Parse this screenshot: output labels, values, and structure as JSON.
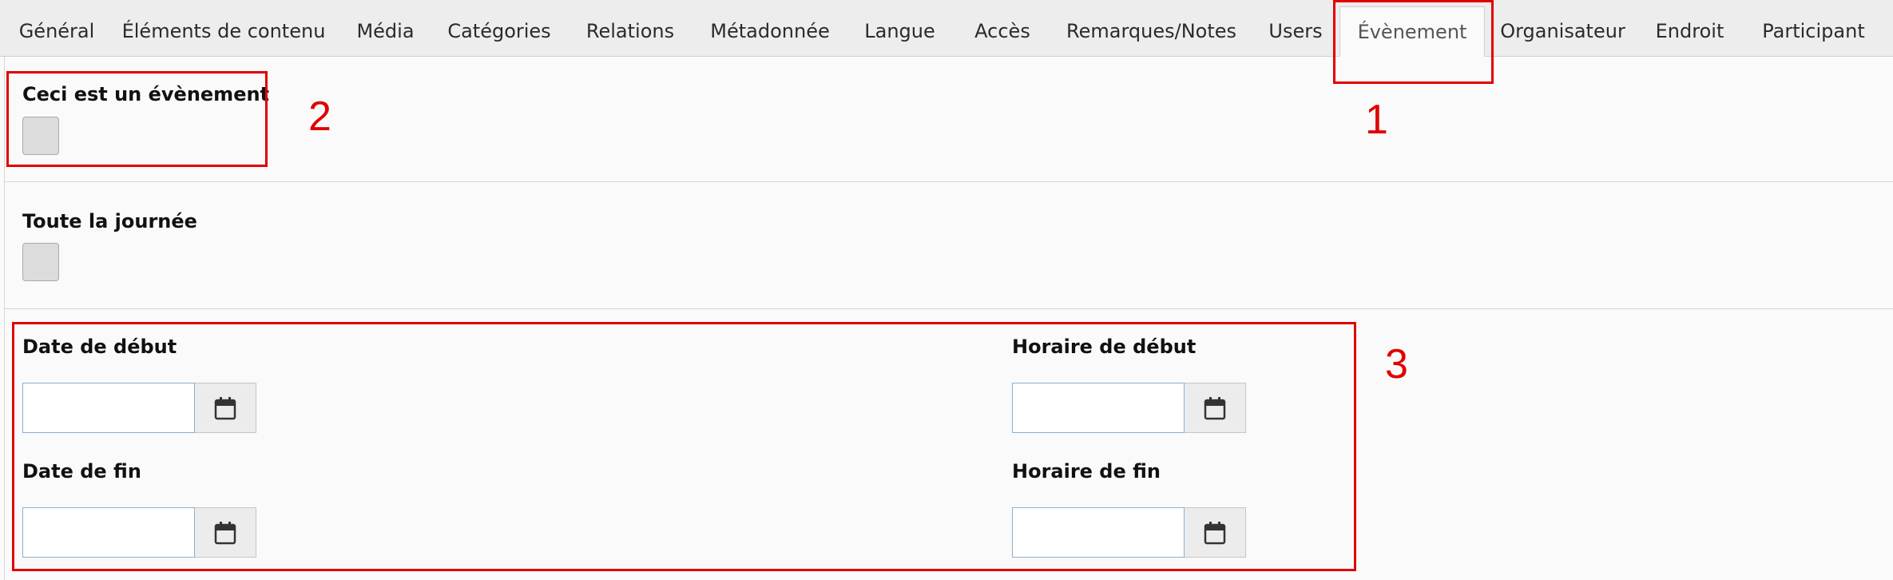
{
  "tabs": [
    {
      "label": "Général"
    },
    {
      "label": "Éléments de contenu"
    },
    {
      "label": "Média"
    },
    {
      "label": "Catégories"
    },
    {
      "label": "Relations"
    },
    {
      "label": "Métadonnée"
    },
    {
      "label": "Langue"
    },
    {
      "label": "Accès"
    },
    {
      "label": "Remarques/Notes"
    },
    {
      "label": "Users"
    },
    {
      "label": "Évènement",
      "active": true
    },
    {
      "label": "Organisateur"
    },
    {
      "label": "Endroit"
    },
    {
      "label": "Participant"
    }
  ],
  "fields": {
    "is_event": {
      "label": "Ceci est un évènement"
    },
    "all_day": {
      "label": "Toute la journée"
    },
    "start_date": {
      "label": "Date de début",
      "value": ""
    },
    "start_time": {
      "label": "Horaire de début",
      "value": ""
    },
    "end_date": {
      "label": "Date de fin",
      "value": ""
    },
    "end_time": {
      "label": "Horaire de fin",
      "value": ""
    }
  },
  "icons": {
    "calendar": "calendar-icon"
  },
  "annotations": {
    "n1": "1",
    "n2": "2",
    "n3": "3",
    "color": "#e00000"
  }
}
